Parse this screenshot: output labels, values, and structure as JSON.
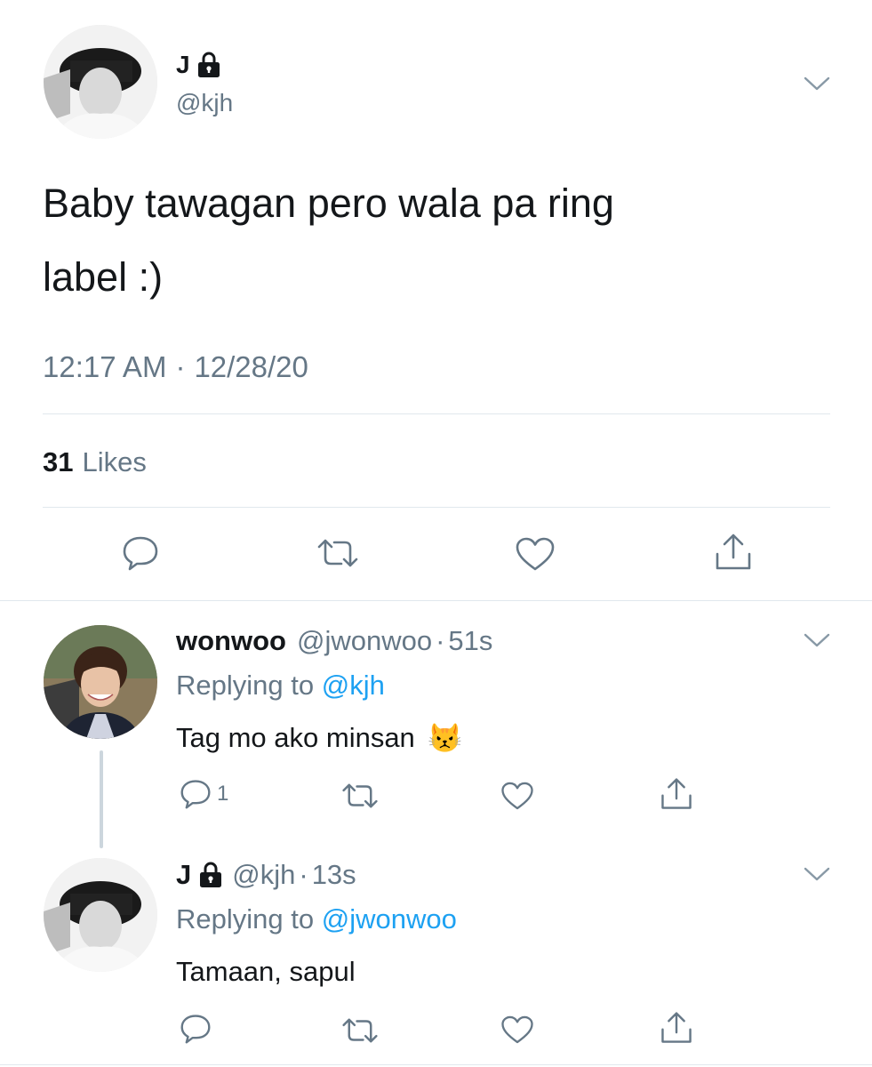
{
  "main_tweet": {
    "author_name": "J",
    "handle": "@kjh",
    "text_line1": "Baby tawagan pero wala pa ring",
    "text_line2": "label :)",
    "time": "12:17 AM",
    "separator": "·",
    "date": "12/28/20",
    "likes_count": "31",
    "likes_label": "Likes",
    "protected": true
  },
  "replies": [
    {
      "author_name": "wonwoo",
      "handle": "@jwonwoo",
      "separator": "·",
      "time_ago": "51s",
      "replying_prefix": "Replying to",
      "replying_to": "@kjh",
      "text": "Tag mo ako minsan",
      "emoji": "😾",
      "reply_count": "1"
    },
    {
      "author_name": "J",
      "handle": "@kjh",
      "separator": "·",
      "time_ago": "13s",
      "replying_prefix": "Replying to",
      "replying_to": "@jwonwoo",
      "text": "Tamaan, sapul",
      "protected": true
    }
  ],
  "icons": {
    "chevron": "chevron-down-icon",
    "lock": "lock-icon",
    "reply": "reply-icon",
    "retweet": "retweet-icon",
    "like": "heart-icon",
    "share": "share-icon"
  },
  "colors": {
    "text": "#14171a",
    "muted": "#657786",
    "link": "#1da1f2",
    "divider": "#e1e8ed"
  }
}
